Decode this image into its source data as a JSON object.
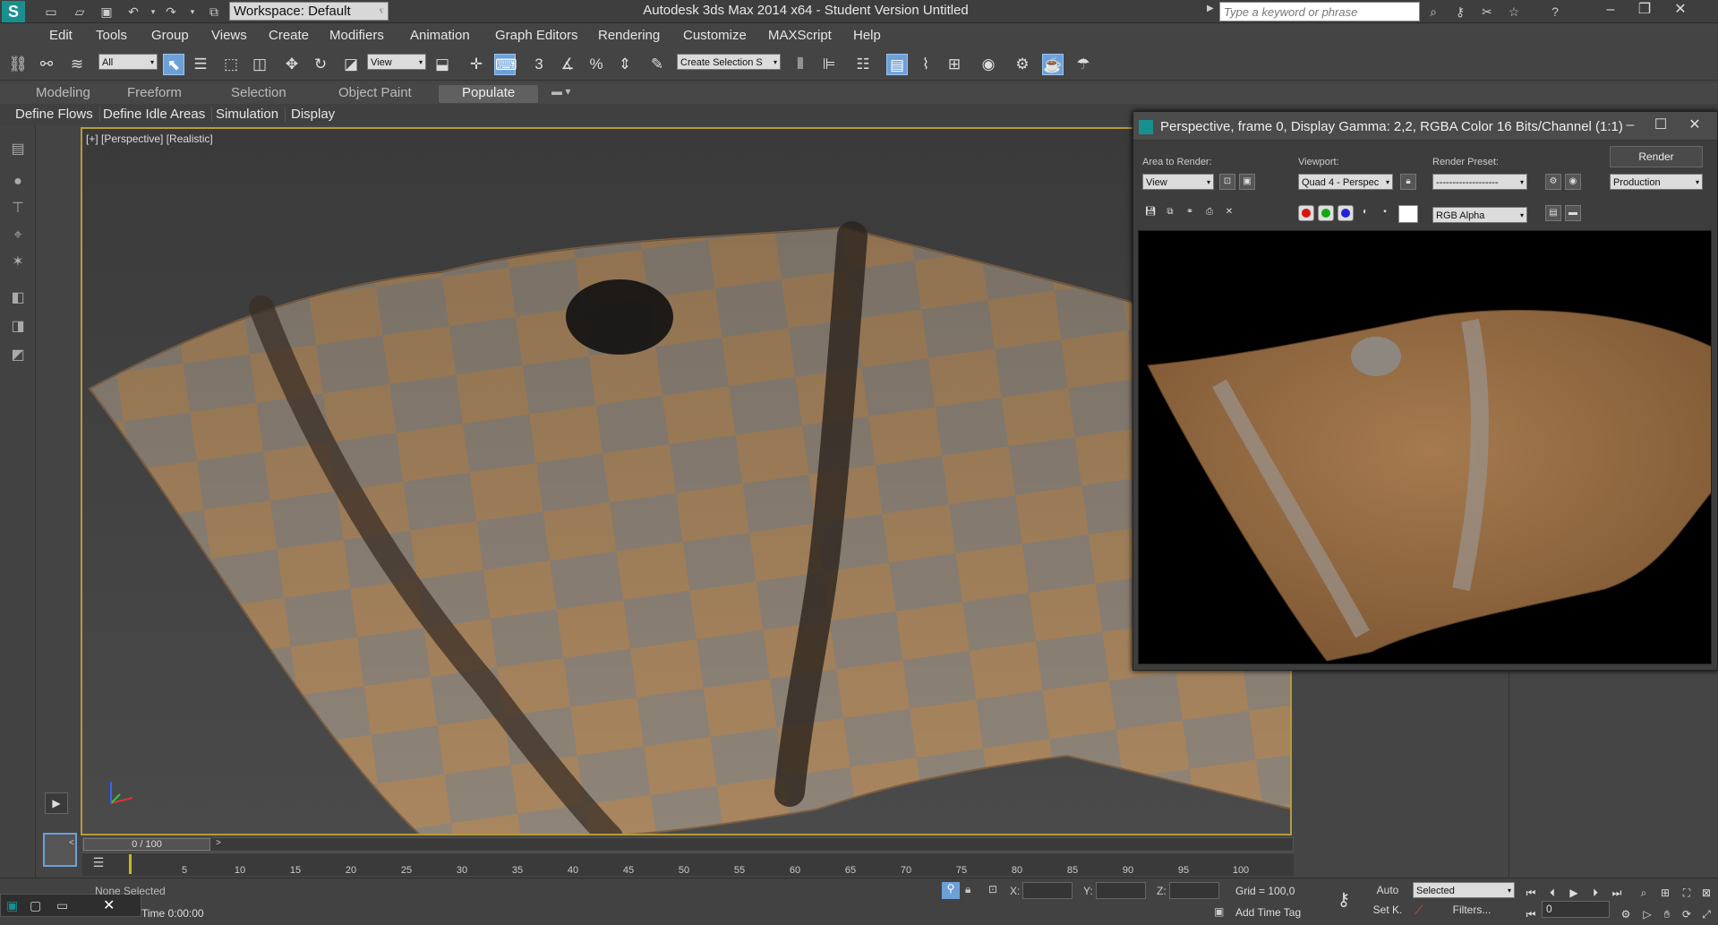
{
  "app": {
    "title": "Autodesk 3ds Max  2014 x64  - Student Version    Untitled",
    "workspace": "Workspace: Default",
    "search_placeholder": "Type a keyword or phrase"
  },
  "menu": [
    "Edit",
    "Tools",
    "Group",
    "Views",
    "Create",
    "Modifiers",
    "Animation",
    "Graph Editors",
    "Rendering",
    "Customize",
    "MAXScript",
    "Help"
  ],
  "toolbar": {
    "selection_filter": "All",
    "ref_coord": "View",
    "named_selection": "Create Selection S"
  },
  "ribbon": {
    "tabs": [
      "Modeling",
      "Freeform",
      "Selection",
      "Object Paint",
      "Populate"
    ],
    "active_tab": "Populate",
    "sub_tabs": [
      "Define Flows",
      "Define Idle Areas",
      "Simulation",
      "Display"
    ]
  },
  "viewport": {
    "label": "[+] [Perspective] [Realistic]",
    "axis_x": "x",
    "axis_y": "y",
    "axis_z": "z"
  },
  "render_window": {
    "title": "Perspective, frame 0, Display Gamma: 2,2, RGBA Color 16 Bits/Channel (1:1)",
    "area_label": "Area to Render:",
    "area_value": "View",
    "viewport_label": "Viewport:",
    "viewport_value": "Quad 4 - Perspec",
    "preset_label": "Render Preset:",
    "preset_value": "-------------------",
    "render_button": "Render",
    "production_value": "Production",
    "channel_value": "RGB Alpha"
  },
  "timeline": {
    "slider": "0 / 100",
    "ticks": [
      "5",
      "10",
      "15",
      "20",
      "25",
      "30",
      "35",
      "40",
      "45",
      "50",
      "55",
      "60",
      "65",
      "70",
      "75",
      "80",
      "85",
      "90",
      "95",
      "100"
    ]
  },
  "status": {
    "selection": "None Selected",
    "time": "Time  0:00:00",
    "x_label": "X:",
    "y_label": "Y:",
    "z_label": "Z:",
    "grid": "Grid = 100,0",
    "add_time_tag": "Add Time Tag",
    "auto": "Auto",
    "set_key": "Set K.",
    "key_filter": "Selected",
    "filters": "Filters...",
    "frame": "0"
  }
}
